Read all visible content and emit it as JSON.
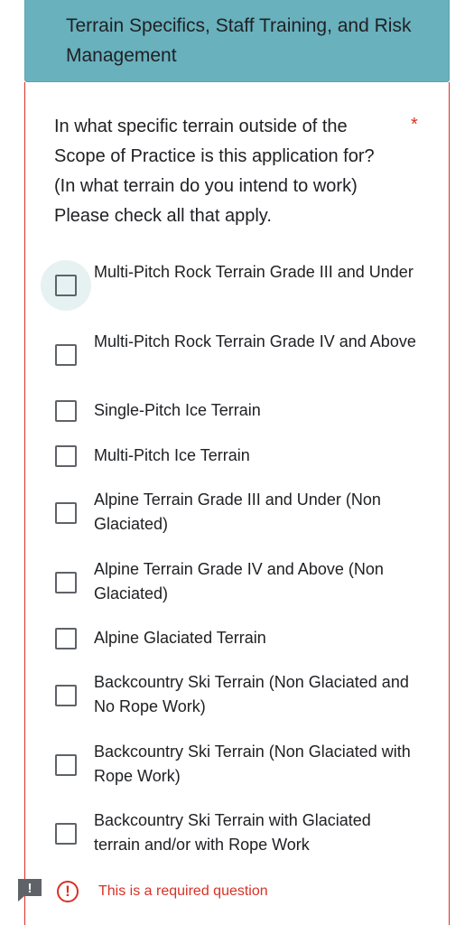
{
  "section": {
    "title": "Terrain Specifics, Staff Training, and Risk Management"
  },
  "question": {
    "text": "In what specific terrain outside of the Scope of Practice is this application for? (In what terrain do you intend to work) Please check all that apply.",
    "required_mark": "*",
    "options": [
      {
        "label": "Multi-Pitch Rock Terrain Grade III and Under",
        "checked": false
      },
      {
        "label": "Multi-Pitch Rock Terrain Grade IV and Above",
        "checked": false
      },
      {
        "label": "Single-Pitch Ice Terrain",
        "checked": false
      },
      {
        "label": "Multi-Pitch Ice Terrain",
        "checked": false
      },
      {
        "label": "Alpine Terrain Grade III and Under (Non Glaciated)",
        "checked": false
      },
      {
        "label": "Alpine Terrain Grade IV and Above (Non Glaciated)",
        "checked": false
      },
      {
        "label": "Alpine Glaciated Terrain",
        "checked": false
      },
      {
        "label": "Backcountry Ski Terrain (Non Glaciated and No Rope Work)",
        "checked": false
      },
      {
        "label": "Backcountry Ski Terrain (Non Glaciated with Rope Work)",
        "checked": false
      },
      {
        "label": "Backcountry Ski Terrain with Glaciated terrain and/or with Rope Work",
        "checked": false
      }
    ]
  },
  "error": {
    "icon_glyph": "!",
    "message": "This is a required question"
  },
  "report": {
    "icon": "feedback-icon",
    "glyph": "!"
  },
  "colors": {
    "header_bg": "#68b1bd",
    "error": "#d93025",
    "focus_ripple": "#e6f1f2"
  }
}
